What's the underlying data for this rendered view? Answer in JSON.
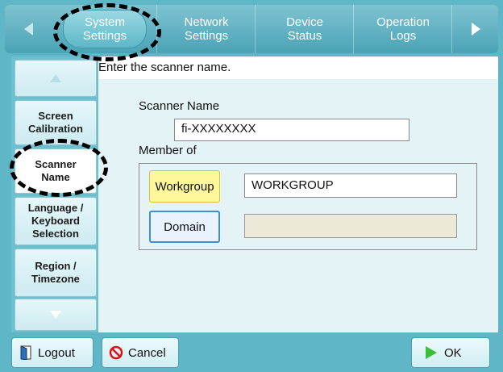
{
  "tabs": [
    {
      "label": "System\nSettings",
      "active": true
    },
    {
      "label": "Network\nSettings",
      "active": false
    },
    {
      "label": "Device\nStatus",
      "active": false
    },
    {
      "label": "Operation\nLogs",
      "active": false
    }
  ],
  "sidebar": {
    "items": [
      {
        "label": "Screen\nCalibration"
      },
      {
        "label": "Scanner\nName",
        "selected": true
      },
      {
        "label": "Language /\nKeyboard\nSelection"
      },
      {
        "label": "Region /\nTimezone"
      }
    ]
  },
  "main": {
    "instruction": "Enter the scanner name.",
    "scanner_name_label": "Scanner Name",
    "scanner_name_value": "fi-XXXXXXXX",
    "member_of_label": "Member of",
    "workgroup_button": "Workgroup",
    "workgroup_value": "WORKGROUP",
    "domain_button": "Domain",
    "domain_value": ""
  },
  "footer": {
    "logout": "Logout",
    "cancel": "Cancel",
    "ok": "OK"
  },
  "colors": {
    "frame": "#5fb6c6",
    "accent_yellow": "#fff89a",
    "accent_blue": "#3f8ed0"
  }
}
